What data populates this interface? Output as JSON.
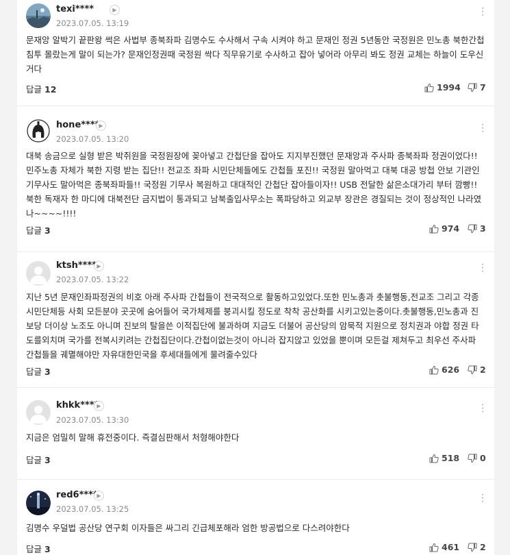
{
  "comments": [
    {
      "nickname": "texi****",
      "date": "2023.07.05. 13:19",
      "text": "문재앙 알박기 끝판왕 썩은 사법부 종북좌파 김명수도 수사해서 구속 시켜야 하고 문재인 정권 5년동안 국정원은 민노총 북한간첩 침투 몰랐는게 말이 되는가? 문재인정권때 국정원 싹다 직무유기로 수사하고 잡아 넣어라 아무리 봐도 정권 교체는 하늘이 도우신 거다",
      "reply_label": "답글",
      "reply_count": "12",
      "likes": "1994",
      "dislikes": "7",
      "avatar": "landscape-icon"
    },
    {
      "nickname": "hone****",
      "date": "2023.07.05. 13:20",
      "text": "대북 송금으로 실형 받은 박쥐원을 국정원장에 꽂아넣고 간첩단을 잡아도 지지부진했던 문재앙과 주사파 종북좌파 정권이었다!! 민주노총 자체가 북한 지령 받는 집단!! 전교조 좌파 시민단체들에도 간첩들 포진!! 국정원 말아먹고 대북 대공 방첩 안보 기관인 기무사도 말아먹은 종북좌파들!! 국정원 기무사 복원하고 대대적인 간첩단 잡아들이자!! USB 전달한 삶은소대가리 부터 깜빵!! 북한 독재자 한 마디에 대북전단 금지법이 통과되고 남북출입사무소는 폭파당하고 외교부 장관은 경질되는 것이 정상적인 나라였나~~~~!!!!",
      "reply_label": "답글",
      "reply_count": "3",
      "likes": "974",
      "dislikes": "3",
      "avatar": "spartan-helmet-icon"
    },
    {
      "nickname": "ktsh****",
      "date": "2023.07.05. 13:22",
      "text": "지난 5년 문재인좌파정권의 비호 아래 주사파 간첩들이 전국적으로 활동하고있었다.또한 민노총과 촛불행동,전교조 그리고 각종 시민단체등 사회 모든분야 곳곳에 숨어들어 국가체제를 붕괴시킬 정도로 착착 공산화를 시키고있는중이다.촛불행동,민노총과 진보당 더이상 노조도 아니며 진보의 탈을쓴 이적집단에 불과하며 지금도 더불어 공산당의 암묵적 지원으로 정치권과 야합 정권 타도를외치며 국가를 전복시키려는 간첩집단이다.간첩이없는것이 아니라 잡지않고 있었을 뿐이며 모든걸 제쳐두고 최우선 주사파 간첩들을 궤멸해야만 자유대한민국을 후세대들에게 물려줄수있다",
      "reply_label": "답글",
      "reply_count": "3",
      "likes": "626",
      "dislikes": "2",
      "avatar": "default-user-icon"
    },
    {
      "nickname": "khkk****",
      "date": "2023.07.05. 13:30",
      "text": "지금은 엄밀히 말해 휴전중이다. 즉결심판해서 처형해야한다",
      "reply_label": "답글",
      "reply_count": "3",
      "likes": "518",
      "dislikes": "0",
      "avatar": "default-user-icon"
    },
    {
      "nickname": "red6****",
      "date": "2023.07.05. 13:25",
      "text": "김명수 우덜법 공산당 연구회 이자들은 싸그리 긴급체포해라 엄한 방공법으로 다스려야한다",
      "reply_label": "답글",
      "reply_count": "3",
      "likes": "461",
      "dislikes": "2",
      "avatar": "night-tower-icon"
    }
  ],
  "colors": {
    "background": "#f3f3f3",
    "card": "#ffffff",
    "date_gray": "#8a8a8a",
    "divider": "#ececec"
  }
}
